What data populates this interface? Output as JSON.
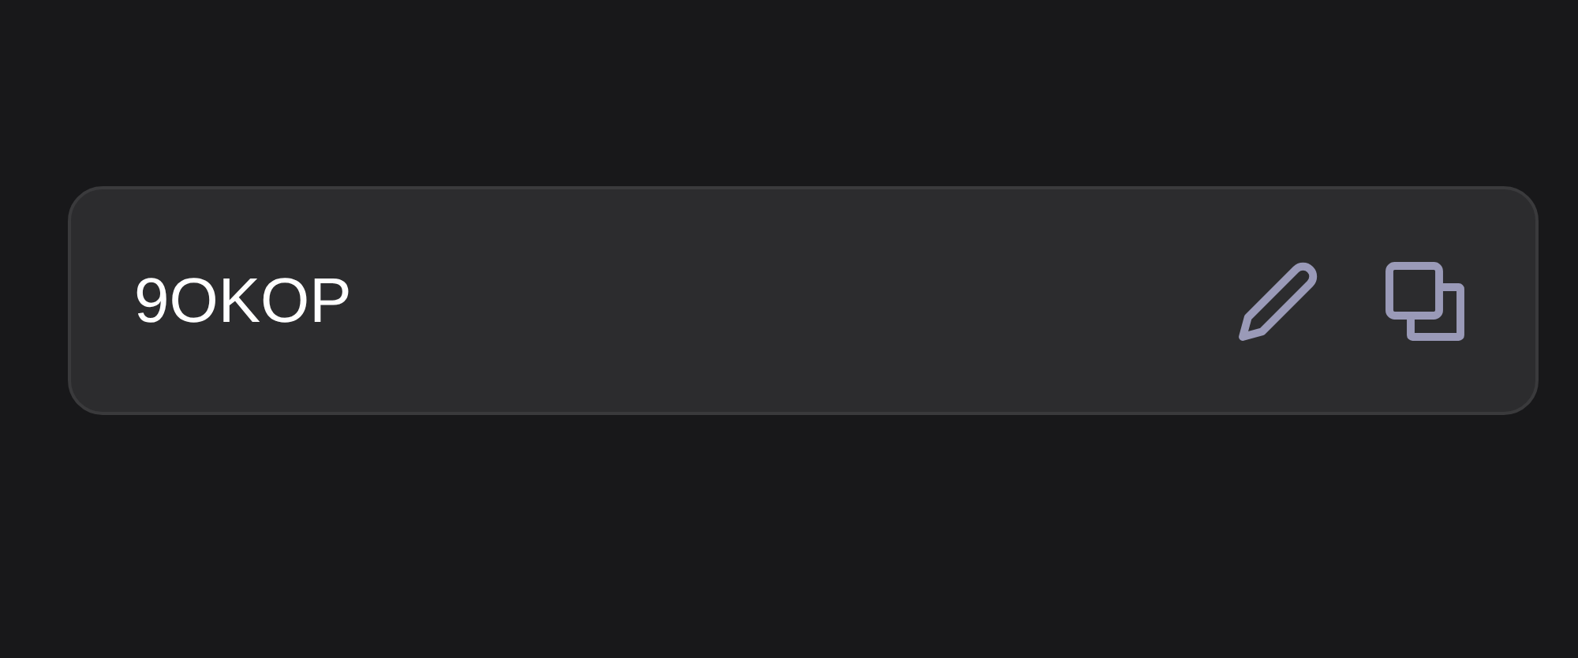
{
  "code_card": {
    "code": "9OKOP"
  }
}
